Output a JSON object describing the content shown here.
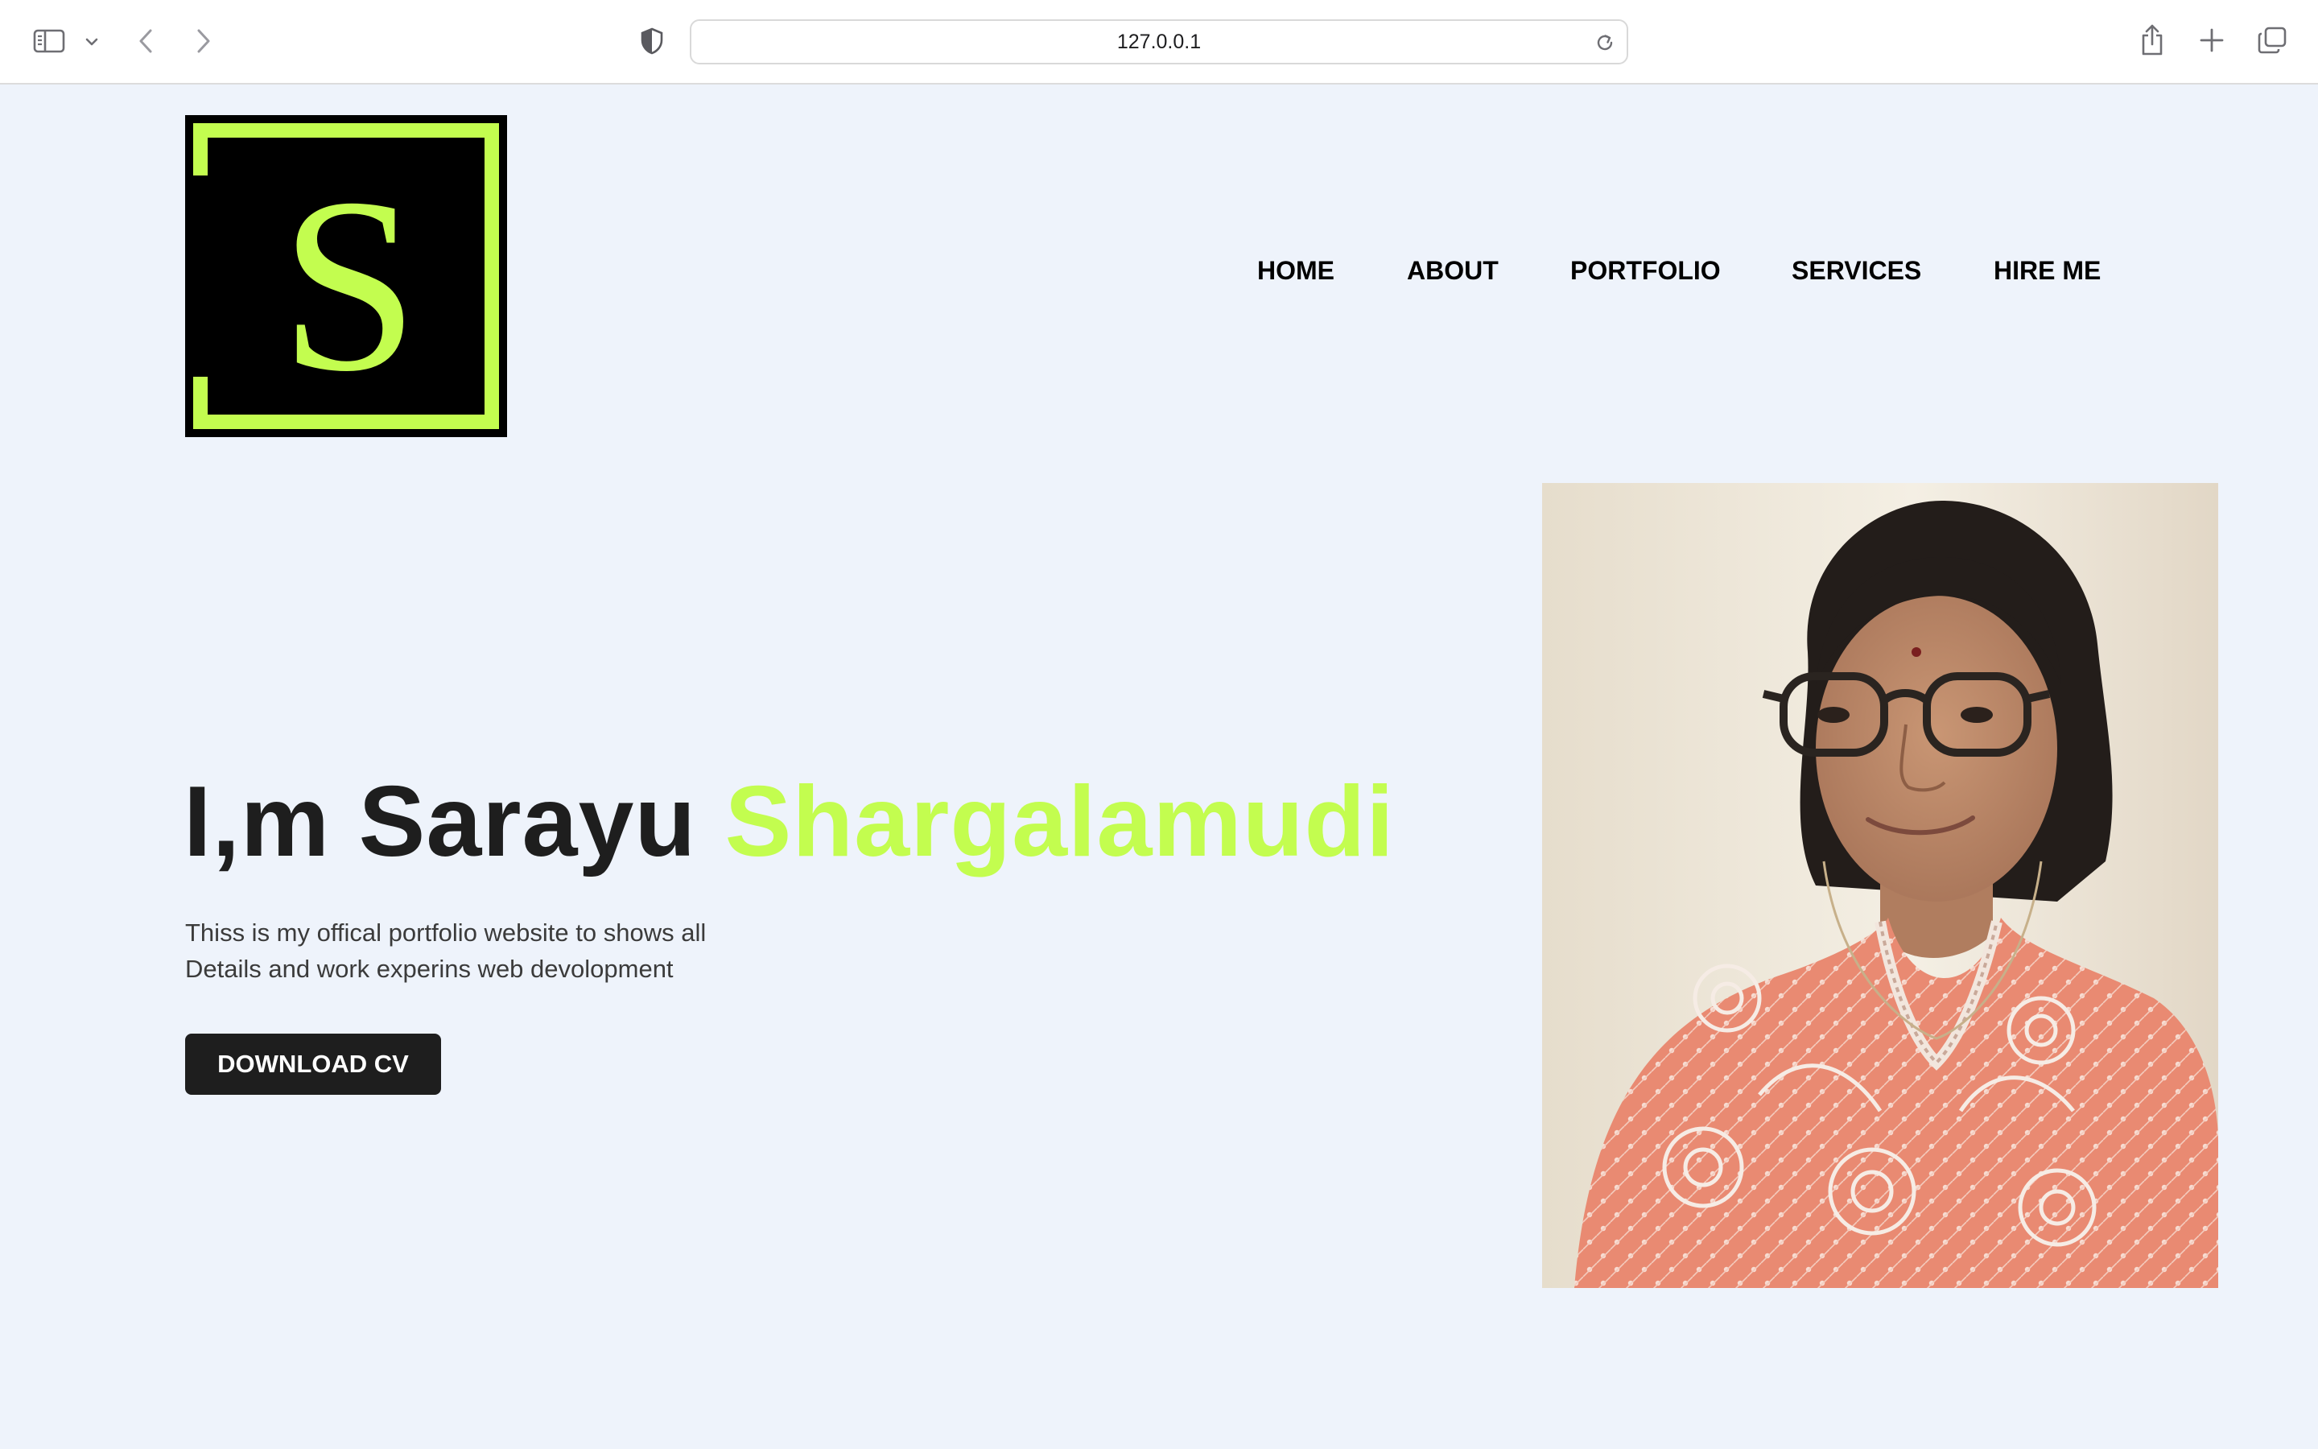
{
  "browser": {
    "url": "127.0.0.1",
    "icons": {
      "sidebar": "sidebar-icon",
      "sidebar_menu": "chevron-down-icon",
      "back": "back-arrow-icon",
      "forward": "forward-arrow-icon",
      "privacy": "shield-icon",
      "reload": "reload-icon",
      "share": "share-icon",
      "new_tab": "plus-icon",
      "tabs": "tab-overview-icon"
    }
  },
  "logo": {
    "letter": "S",
    "colors": {
      "background": "#000000",
      "accent": "#c3fd4f"
    }
  },
  "nav": {
    "items": [
      {
        "label": "HOME"
      },
      {
        "label": "ABOUT"
      },
      {
        "label": "PORTFOLIO"
      },
      {
        "label": "SERVICES"
      },
      {
        "label": "HIRE ME"
      }
    ]
  },
  "hero": {
    "title_prefix": "I,m Sarayu",
    "title_accent": "Shargalamudi",
    "description_line1": "Thiss is my offical portfolio website to shows all",
    "description_line2": "Details and work experins web devolopment",
    "cta_label": "DOWNLOAD CV"
  },
  "colors": {
    "page_background": "#eef3fb",
    "accent": "#c3fd4f",
    "text_dark": "#1e1e1e",
    "button_background": "#1e1e1e",
    "button_text": "#ffffff"
  }
}
